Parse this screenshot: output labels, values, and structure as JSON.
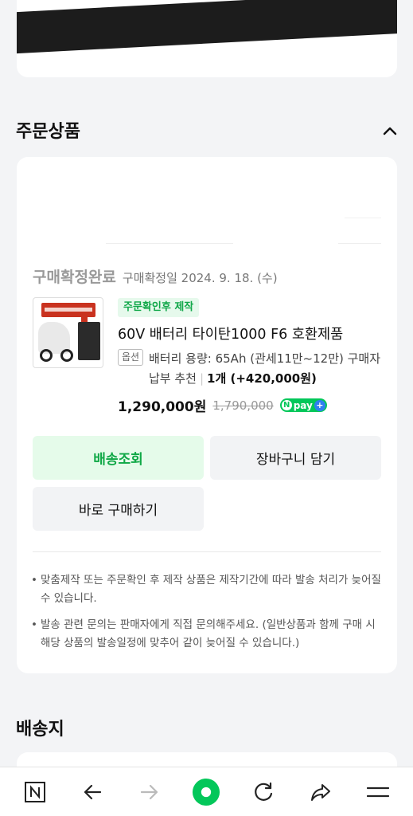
{
  "order_section": {
    "title": "주문상품",
    "status": "구매확정완료",
    "confirm_date": "구매확정일 2024. 9. 18. (수)",
    "product": {
      "tag": "주문확인후 제작",
      "name": "60V 배터리 타이탄1000 F6 호환제품",
      "option_label": "옵션",
      "option_value": "배터리 용량: 65Ah (관세11만~12만) 구매자납부 추천",
      "quantity": "1개 (+420,000원)",
      "price": "1,290,000원",
      "original_price": "1,790,000",
      "npay_label": "pay"
    },
    "buttons": {
      "track": "배송조회",
      "cart": "장바구니 담기",
      "buy_now": "바로 구매하기"
    },
    "notes": [
      "맞춤제작 또는 주문확인 후 제작 상품은 제작기간에 따라 발송 처리가 늦어질 수 있습니다.",
      "발송 관련 문의는 판매자에게 직접 문의해주세요. (일반상품과 함께 구매 시 해당 상품의 발송일정에 맞추어 같이 늦어질 수 있습니다.)"
    ]
  },
  "shipping_section": {
    "title": "배송지"
  },
  "bottom_bar": {
    "icons": [
      "naver-home-icon",
      "back-arrow-icon",
      "forward-arrow-icon",
      "green-dot-icon",
      "refresh-icon",
      "share-icon",
      "menu-icon"
    ]
  },
  "colors": {
    "accent_green": "#03c75a",
    "tag_green_text": "#12a84a",
    "background": "#f3f4f6"
  }
}
